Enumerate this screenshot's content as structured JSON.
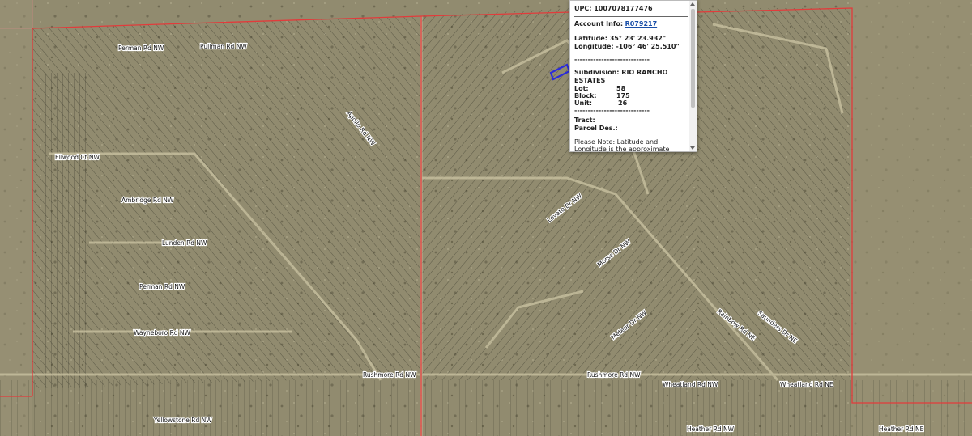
{
  "popup": {
    "upc": "UPC: 1007078177476",
    "account_label": "Account Info:",
    "account_link": "R079217",
    "latitude": "Latitude: 35° 23' 23.932\"",
    "longitude": "Longitude: -106° 46' 25.510\"",
    "divider": "----------------------------",
    "subdivision": "Subdivision: RIO RANCHO ESTATES",
    "fields": [
      {
        "label": "Lot:",
        "value": "58"
      },
      {
        "label": "Block:",
        "value": "175"
      },
      {
        "label": "Unit:",
        "value": "26"
      }
    ],
    "tract": "Tract:",
    "parcel_des": "Parcel Des.:",
    "note": "Please Note: Latitude and Longitude is the approximate center of the parcel shown."
  },
  "roads": [
    "Perman Rd NW",
    "Pullman Rd NW",
    "Ellwood Ct NW",
    "Ambridge Rd NW",
    "Lunden Rd NW",
    "Wayneboro Rd NW",
    "Rushmore Rd NW",
    "Rushmore Rd NW",
    "Wheatland Rd NW",
    "Wheatland Rd NE",
    "Yellowstone Rd NW",
    "Heather Rd NW",
    "Heather Rd NE",
    "Morse Dr NW",
    "Lovato Dr NW",
    "Meteor Dr NW",
    "Rainbow Rd NE",
    "Saunders Dr NE",
    "Apollo Rd NW"
  ],
  "colors": {
    "terrain": "#8f8a6d",
    "parcel_line": "#3a3a2e",
    "boundary": "#e23b3b",
    "highlight": "#2b2bdc",
    "popup_link": "#1a4fa8"
  }
}
